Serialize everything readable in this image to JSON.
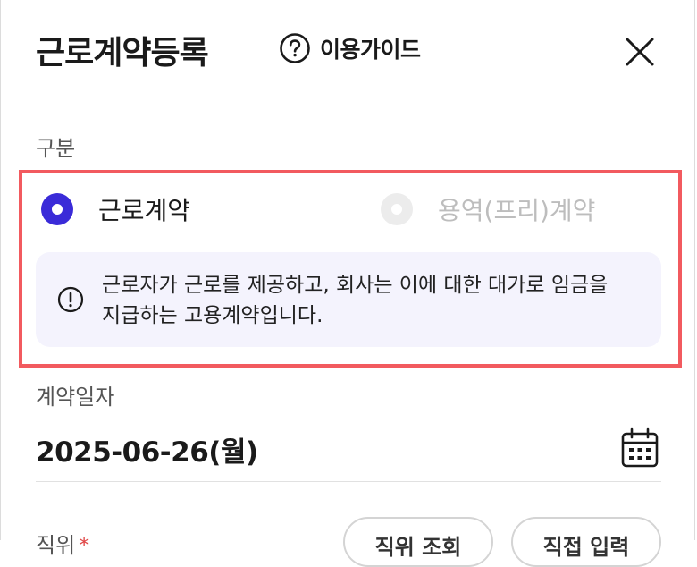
{
  "header": {
    "title": "근로계약등록",
    "guide_label": "이용가이드",
    "guide_icon": "question-circle-icon",
    "close_icon": "close-icon"
  },
  "contract_type": {
    "label": "구분",
    "options": [
      {
        "label": "근로계약",
        "selected": true
      },
      {
        "label": "용역(프리)계약",
        "selected": false
      }
    ],
    "notice_icon": "exclamation-circle-icon",
    "notice": "근로자가 근로를 제공하고, 회사는 이에 대한 대가로 임금을 지급하는 고용계약입니다."
  },
  "contract_date": {
    "label": "계약일자",
    "value": "2025-06-26(월)",
    "calendar_icon": "calendar-icon"
  },
  "job": {
    "label": "직위",
    "required_mark": "*",
    "buttons": [
      "직위 조회",
      "직접 입력"
    ]
  },
  "colors": {
    "accent": "#3a2bd8",
    "highlight_border": "#f25a5f",
    "notice_bg": "#f4f3fd",
    "required": "#e04848"
  }
}
